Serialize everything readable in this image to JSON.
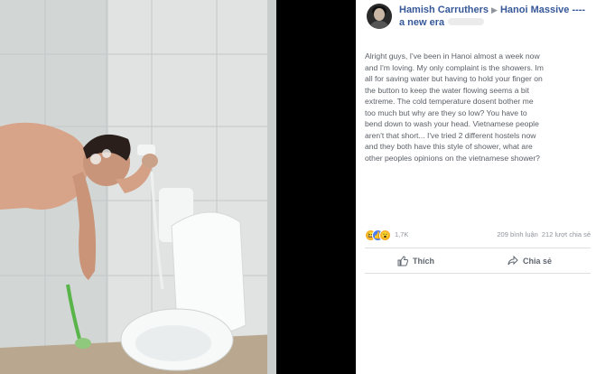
{
  "post": {
    "author": "Hamish Carruthers",
    "group_line1": "Hanoi Massive ----",
    "group_line2": "a new era",
    "body_lines": [
      "Alright guys, I've been in Hanoi almost a week now",
      "and I'm loving. My only complaint is the showers. Im",
      "all for saving water but having to hold your finger on",
      "the button to keep the water flowing seems a bit",
      "extreme. The cold temperature dosent bother me",
      "too much but why are they so low? You have to",
      "bend down to wash your head. Vietnamese people",
      "aren't that short... I've tried 2 different hostels now",
      "and they both have this style of shower, what are",
      "other peoples opinions on the vietnamese shower?"
    ],
    "reaction_count": "1,7K",
    "comments": "209 bình luận",
    "shares": "212 lượt chia sẻ",
    "like_label": "Thích",
    "share_label": "Chia sẻ"
  },
  "icons": {
    "reactions": [
      "haha-icon",
      "like-icon",
      "wow-icon"
    ],
    "like_action": "thumbs-up-icon",
    "share_action": "share-arrow-icon"
  },
  "colors": {
    "link_blue": "#365899",
    "muted_text": "#90949c",
    "like_blue": "#4a7cf0",
    "reaction_yellow": "#f7b125"
  }
}
